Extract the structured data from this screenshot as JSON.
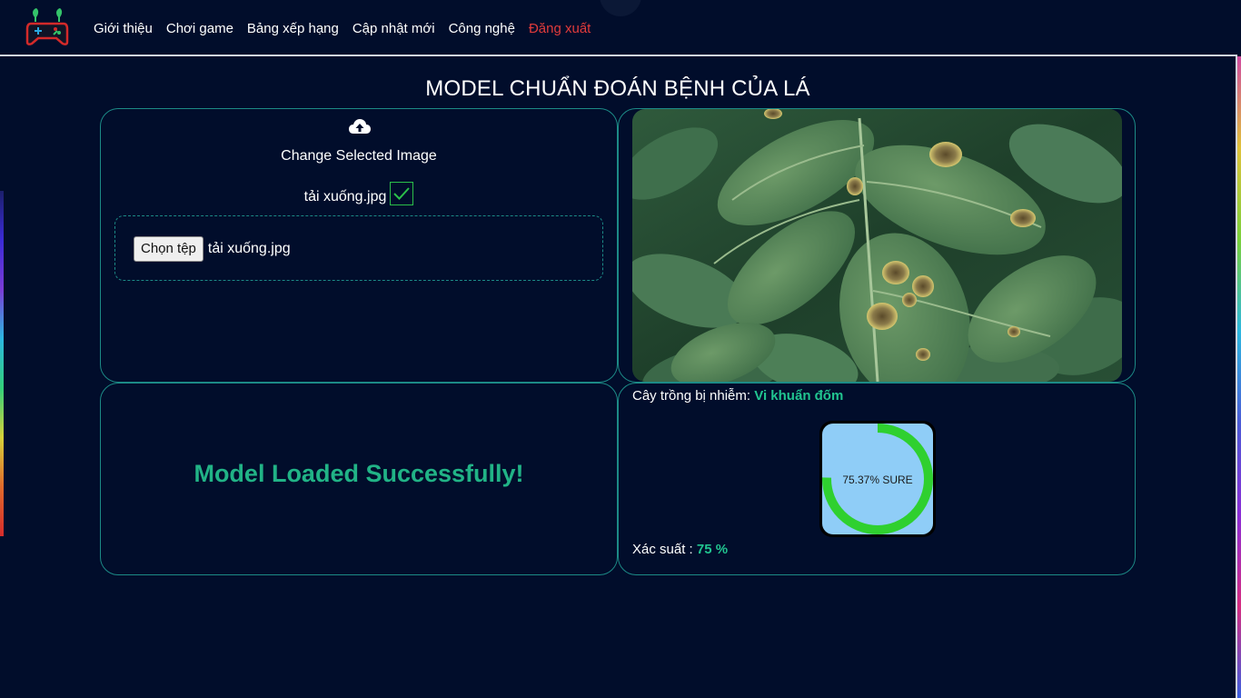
{
  "nav": {
    "logo_icon": "gamepad-logo-icon",
    "links": [
      {
        "label": "Giới thiệu"
      },
      {
        "label": "Chơi game"
      },
      {
        "label": "Bảng xếp hạng"
      },
      {
        "label": "Cập nhật mới"
      },
      {
        "label": "Công nghệ"
      },
      {
        "label": "Đăng xuất"
      }
    ]
  },
  "page": {
    "title": "MODEL CHUẨN ĐOÁN BỆNH CỦA LÁ"
  },
  "upload": {
    "icon": "cloud-upload-icon",
    "change_label": "Change Selected Image",
    "file_name": "tải xuống.jpg",
    "check_icon": "checkmark-icon",
    "choose_button": "Chọn tệp",
    "chosen_file": "tải xuống.jpg"
  },
  "status": {
    "message": "Model Loaded Successfully!"
  },
  "result": {
    "infected_label": "Cây trồng bị nhiễm: ",
    "disease": "Vi khuẩn đốm",
    "confidence_fraction": 0.7537,
    "gauge_text": "75.37% SURE",
    "probability_label": "Xác suất : ",
    "probability_value": "75 %"
  },
  "colors": {
    "background": "#010d2b",
    "panel_border": "#1c8a86",
    "accent_green": "#21b386",
    "logout_red": "#e23b3b",
    "gauge_ring": "#2fd02f",
    "gauge_fill": "#8fcdf7"
  }
}
